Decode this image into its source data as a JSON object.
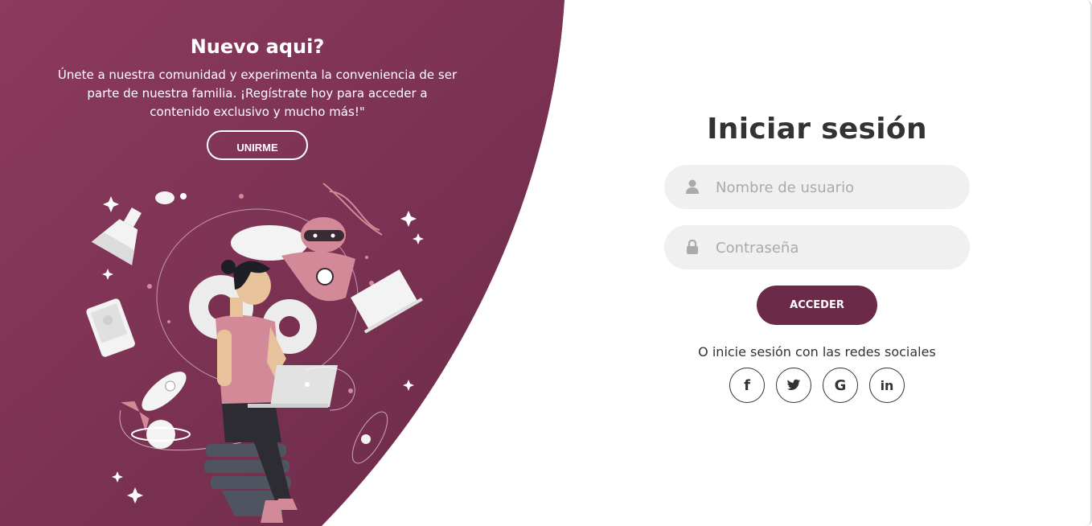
{
  "left_panel": {
    "title": "Nuevo aqui?",
    "description": "Únete a nuestra comunidad y experimenta la conveniencia de ser parte de nuestra familia. ¡Regístrate hoy para acceder a contenido exclusivo y mucho más!\"",
    "join_label": "UNIRME"
  },
  "login": {
    "title": "Iniciar sesión",
    "username_placeholder": "Nombre de usuario",
    "password_placeholder": "Contraseña",
    "submit_label": "ACCEDER",
    "social_text": "O inicie sesión con las redes sociales",
    "socials": [
      {
        "icon": "facebook-icon",
        "glyph": "f"
      },
      {
        "icon": "twitter-icon",
        "glyph": "🐦"
      },
      {
        "icon": "google-icon",
        "glyph": "G"
      },
      {
        "icon": "linkedin-icon",
        "glyph": "in"
      }
    ]
  },
  "colors": {
    "brand": "#6b2a48",
    "brand_dark": "#7a3050",
    "input_bg": "#f0f0f0",
    "text": "#333333"
  }
}
